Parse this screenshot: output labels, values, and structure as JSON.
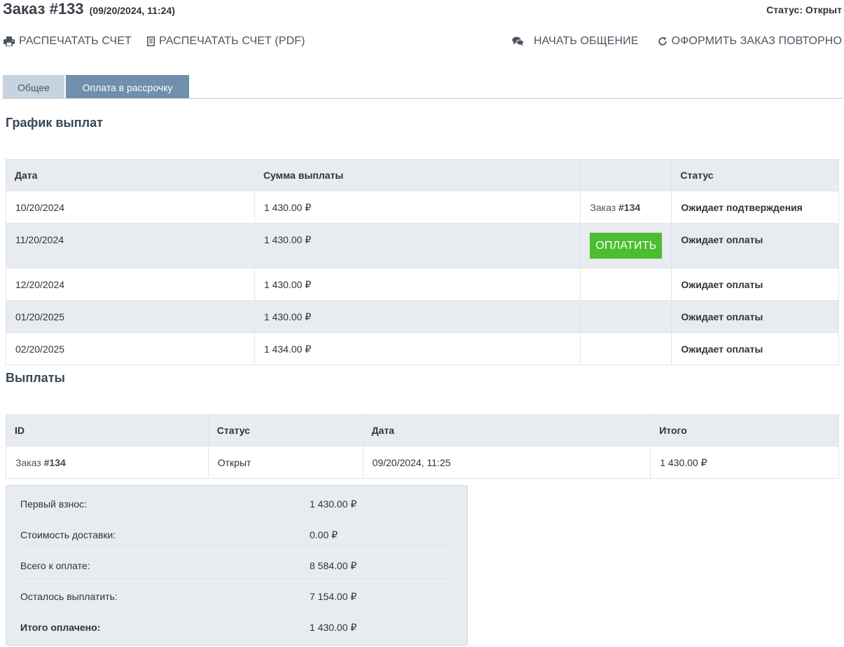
{
  "header": {
    "title": "Заказ #133",
    "datetime": "(09/20/2024, 11:24)",
    "status": "Статус: Открыт"
  },
  "actions": {
    "print_invoice": "РАСПЕЧАТАТЬ СЧЕТ",
    "print_invoice_pdf": "РАСПЕЧАТАТЬ СЧЕТ (PDF)",
    "start_chat": "НАЧАТЬ ОБЩЕНИЕ",
    "reorder": "ОФОРМИТЬ ЗАКАЗ ПОВТОРНО"
  },
  "tabs": {
    "general": "Общее",
    "installment": "Оплата в рассрочку",
    "active": "installment"
  },
  "schedule": {
    "title": "График выплат",
    "columns": [
      "Дата",
      "Сумма выплаты",
      "",
      "Статус"
    ],
    "pay_button_label": "ОПЛАТИТЬ",
    "rows": [
      {
        "date": "10/20/2024",
        "amount": "1 430.00 ₽",
        "action_prefix": "Заказ",
        "action_number": "#134",
        "status": "Ожидает подтверждения"
      },
      {
        "date": "11/20/2024",
        "amount": "1 430.00 ₽",
        "status": "Ожидает оплаты"
      },
      {
        "date": "12/20/2024",
        "amount": "1 430.00 ₽",
        "status": "Ожидает оплаты"
      },
      {
        "date": "01/20/2025",
        "amount": "1 430.00 ₽",
        "status": "Ожидает оплаты"
      },
      {
        "date": "02/20/2025",
        "amount": "1 434.00 ₽",
        "status": "Ожидает оплаты"
      }
    ]
  },
  "payments": {
    "title": "Выплаты",
    "columns": [
      "ID",
      "Статус",
      "Дата",
      "Итого"
    ],
    "rows": [
      {
        "id_prefix": "Заказ",
        "id_number": "#134",
        "status": "Открыт",
        "date": "09/20/2024, 11:25",
        "total": "1 430.00 ₽"
      }
    ]
  },
  "summary": [
    {
      "label": "Первый взнос:",
      "value": "1 430.00 ₽"
    },
    {
      "label": "Стоимость доставки:",
      "value": "0.00 ₽"
    },
    {
      "label": "Всего к оплате:",
      "value": "8 584.00 ₽"
    },
    {
      "label": "Осталось выплатить:",
      "value": "7 154.00 ₽"
    },
    {
      "label": "Итого оплачено:",
      "value": "1 430.00 ₽"
    }
  ],
  "colors": {
    "pay_button": "#4cbd30",
    "active_tab": "#6f8fad",
    "inactive_tab": "#c7d3df",
    "table_header": "#e8ebef"
  },
  "icons": [
    "printer-icon",
    "document-icon",
    "chat-icon",
    "refresh-icon"
  ]
}
